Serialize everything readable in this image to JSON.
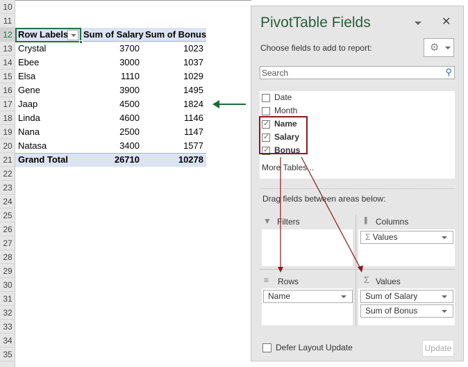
{
  "rows": [
    "10",
    "11",
    "12",
    "13",
    "14",
    "15",
    "16",
    "17",
    "18",
    "19",
    "20",
    "21",
    "22",
    "23",
    "24",
    "25",
    "26",
    "27",
    "28",
    "29",
    "30",
    "31",
    "32",
    "33",
    "34",
    "35"
  ],
  "pivot": {
    "headers": [
      "Row Labels",
      "Sum of Salary",
      "Sum of Bonus"
    ],
    "data": [
      [
        "Crystal",
        "3700",
        "1023"
      ],
      [
        "Ebee",
        "3000",
        "1037"
      ],
      [
        "Elsa",
        "1110",
        "1029"
      ],
      [
        "Gene",
        "3900",
        "1495"
      ],
      [
        "Jaap",
        "4500",
        "1824"
      ],
      [
        "Linda",
        "4600",
        "1146"
      ],
      [
        "Nana",
        "2500",
        "1147"
      ],
      [
        "Natasa",
        "3400",
        "1577"
      ]
    ],
    "total": [
      "Grand Total",
      "26710",
      "10278"
    ]
  },
  "panel": {
    "title": "PivotTable Fields",
    "choose": "Choose fields to add to report:",
    "search_placeholder": "Search",
    "fields": [
      {
        "label": "Date",
        "checked": false
      },
      {
        "label": "Month",
        "checked": false
      },
      {
        "label": "Name",
        "checked": true
      },
      {
        "label": "Salary",
        "checked": true
      },
      {
        "label": "Bonus",
        "checked": true
      }
    ],
    "more_tables": "More Tables...",
    "drag": "Drag fields between areas below:",
    "filters": "Filters",
    "columns": "Columns",
    "columns_items": [
      "Values"
    ],
    "rows": "Rows",
    "rows_items": [
      "Name"
    ],
    "values": "Values",
    "values_items": [
      "Sum of Salary",
      "Sum of Bonus"
    ],
    "defer": "Defer Layout Update",
    "update": "Update"
  },
  "colors": {
    "annotation_arrow": "#1e6b35",
    "highlight_box": "#8b1a1a",
    "pivot_header": "#dce4f2"
  }
}
